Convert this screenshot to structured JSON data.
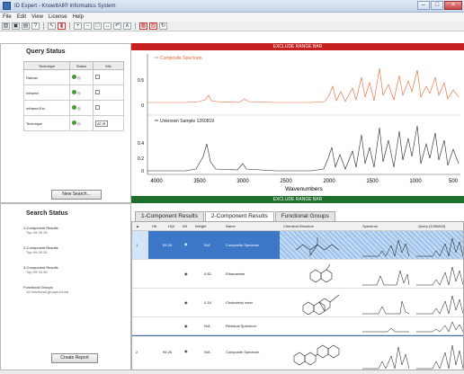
{
  "window": {
    "title": "ID Expert - KnowItAll® Informatics System"
  },
  "menu": [
    "File",
    "Edit",
    "View",
    "License",
    "Help"
  ],
  "query_status": {
    "title": "Query Status",
    "columns": [
      "Technique",
      "Status",
      "Mix"
    ],
    "rows": [
      {
        "technique": "Raman",
        "mix": ""
      },
      {
        "technique": "Infrared",
        "mix": ""
      },
      {
        "technique": "Infrared Ext.",
        "mix": ""
      },
      {
        "technique": "Technique",
        "mix": "AT.IR"
      }
    ],
    "new_search_label": "New Search..."
  },
  "search_status": {
    "title": "Search Status",
    "items": [
      {
        "label": "1-Component Results",
        "sub": "Top Hit 36.35"
      },
      {
        "label": "2-Component Results",
        "sub": "Top Hit 95.26"
      },
      {
        "label": "3-Component Results",
        "sub": "Top Hit 94.96"
      },
      {
        "label": "Functional Groups",
        "sub": "16 functional groups found"
      }
    ],
    "create_report_label": "Create Report"
  },
  "spectra": {
    "top_bar": "EXCLUDE RANGE BAR",
    "bottom_bar": "EXCLUDE RANGE BAR",
    "top_legend": "Composite Spectrum",
    "bottom_legend": "Unknown Sample 1260819",
    "xlabel": "Wavenumbers",
    "x_ticks": [
      "4000",
      "3500",
      "3000",
      "2500",
      "2000",
      "1500",
      "1000",
      "500"
    ],
    "top_y_ticks": [
      "0.5",
      "0"
    ],
    "bottom_y_ticks": [
      "0.4",
      "0.2",
      "0"
    ],
    "colors": {
      "top": "#e8622c",
      "bottom": "#222222"
    }
  },
  "results": {
    "tabs": [
      "1-Component Results",
      "2-Component Results",
      "Functional Groups"
    ],
    "active_tab": 1,
    "headers": [
      "Hit",
      "HQI",
      "Wt",
      "Weight",
      "Name",
      "Chemical Structure",
      "Spectrum",
      "Query (1260819)"
    ],
    "rows": [
      {
        "hit": "1",
        "hqi": "95.26",
        "weight": "N/A",
        "name": "Composite Spectrum",
        "selected": true
      },
      {
        "hit": "",
        "hqi": "",
        "weight": "0.82",
        "name": "Ethanamine",
        "selected": false
      },
      {
        "hit": "",
        "hqi": "",
        "weight": "0.18",
        "name": "Cholesteryl ester",
        "selected": false
      },
      {
        "hit": "",
        "hqi": "",
        "weight": "N/A",
        "name": "Residual Spectrum",
        "selected": false
      },
      {
        "hit": "2",
        "hqi": "95.26",
        "weight": "N/A",
        "name": "Composite Spectrum",
        "selected": false
      }
    ]
  }
}
